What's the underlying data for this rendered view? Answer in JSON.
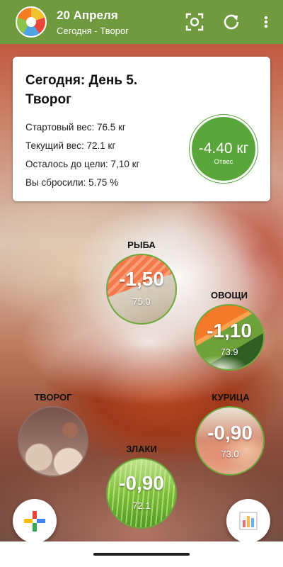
{
  "app_bar": {
    "title": "20 Апреля",
    "subtitle": "Сегодня - Творог",
    "icons": [
      "app-logo",
      "scan-icon",
      "refresh-icon",
      "more-vert-icon"
    ]
  },
  "summary": {
    "title": "Сегодня: День 5. Творог",
    "start_weight": "Стартовый вес: 76.5 кг",
    "current_weight": "Текущий вес: 72.1 кг",
    "to_goal": "Осталось до цели: 7,10 кг",
    "lost": "Вы сбросили: 5.75 %",
    "badge_value": "-4.40 кг",
    "badge_label": "Отвес"
  },
  "days": {
    "fish": {
      "label": "РЫБА",
      "delta": "-1,50",
      "weight": "75.0"
    },
    "vegetables": {
      "label": "ОВОЩИ",
      "delta": "-1,10",
      "weight": "73.9"
    },
    "curd": {
      "label": "ТВОРОГ"
    },
    "chicken": {
      "label": "КУРИЦА",
      "delta": "-0,90",
      "weight": "73.0"
    },
    "grains": {
      "label": "ЗЛАКИ",
      "delta": "-0,90",
      "weight": "72.1"
    }
  },
  "colors": {
    "app_bar": "#6f9a3d",
    "badge": "#59a73b"
  },
  "fab_icons": [
    "add-plus-icon",
    "bar-chart-icon"
  ]
}
